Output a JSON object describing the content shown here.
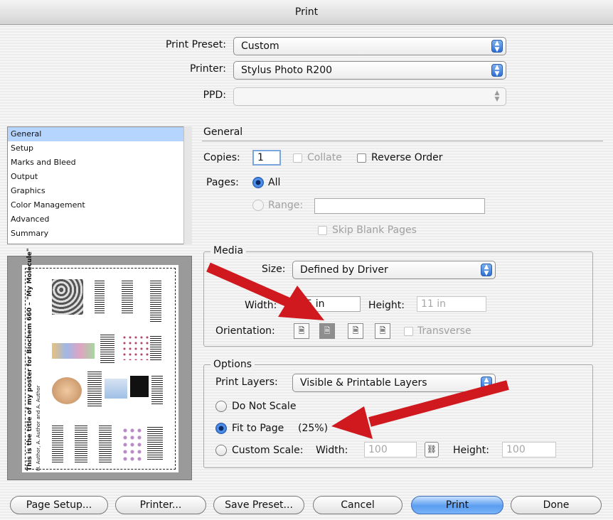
{
  "window": {
    "title": "Print"
  },
  "top": {
    "preset_label": "Print Preset:",
    "preset_value": "Custom",
    "printer_label": "Printer:",
    "printer_value": "Stylus Photo R200",
    "ppd_label": "PPD:",
    "ppd_value": ""
  },
  "sidebar": {
    "items": [
      {
        "label": "General",
        "selected": true
      },
      {
        "label": "Setup"
      },
      {
        "label": "Marks and Bleed"
      },
      {
        "label": "Output"
      },
      {
        "label": "Graphics"
      },
      {
        "label": "Color Management"
      },
      {
        "label": "Advanced"
      },
      {
        "label": "Summary"
      }
    ]
  },
  "preview": {
    "page_title": "This is the title of my poster for Biochem 660 – \"My Molecule\"",
    "page_subtitle": "H. Author, A. Author and A. Author"
  },
  "general": {
    "heading": "General",
    "copies_label": "Copies:",
    "copies_value": "1",
    "collate_label": "Collate",
    "reverse_label": "Reverse Order",
    "pages_label": "Pages:",
    "all_label": "All",
    "range_label": "Range:",
    "range_value": "",
    "skip_label": "Skip Blank Pages"
  },
  "media": {
    "title": "Media",
    "size_label": "Size:",
    "size_value": "Defined by Driver",
    "width_label": "Width:",
    "width_value": "8.5 in",
    "height_label": "Height:",
    "height_value": "11 in",
    "orientation_label": "Orientation:",
    "transverse_label": "Transverse"
  },
  "options": {
    "title": "Options",
    "layers_label": "Print Layers:",
    "layers_value": "Visible & Printable Layers",
    "no_scale_label": "Do Not Scale",
    "fit_label": "Fit to Page",
    "fit_percent": "(25%)",
    "custom_label": "Custom Scale:",
    "cs_width_label": "Width:",
    "cs_width_value": "100",
    "cs_height_label": "Height:",
    "cs_height_value": "100"
  },
  "buttons": {
    "page_setup": "Page Setup...",
    "printer": "Printer...",
    "save_preset": "Save Preset...",
    "cancel": "Cancel",
    "print": "Print",
    "done": "Done"
  },
  "colors": {
    "arrow": "#d0191e",
    "selection": "#b5d5fe",
    "accent": "#3b7de0"
  }
}
